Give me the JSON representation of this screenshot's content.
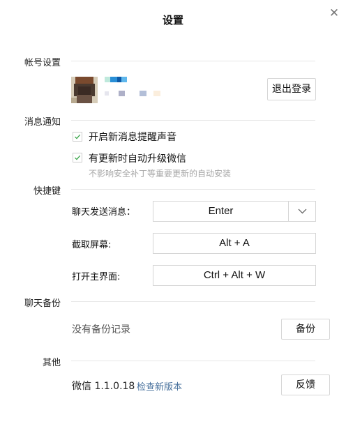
{
  "window": {
    "title": "设置"
  },
  "account": {
    "section_label": "帐号设置",
    "logout_label": "退出登录"
  },
  "notify": {
    "section_label": "消息通知",
    "opt_sound": "开启新消息提醒声音",
    "opt_autoupdate": "有更新时自动升级微信",
    "autoupdate_hint": "不影响安全补丁等重要更新的自动安装",
    "opt_sound_checked": true,
    "opt_autoupdate_checked": true
  },
  "shortcuts": {
    "section_label": "快捷键",
    "send_label": "聊天发送消息：",
    "send_value": "Enter",
    "capture_label": "截取屏幕:",
    "capture_value": "Alt + A",
    "open_label": "打开主界面:",
    "open_value": "Ctrl + Alt + W"
  },
  "backup": {
    "section_label": "聊天备份",
    "empty_text": "没有备份记录",
    "backup_label": "备份"
  },
  "other": {
    "section_label": "其他",
    "version": "微信 1.1.0.18",
    "check_update": "检查新版本",
    "feedback_label": "反馈"
  },
  "colors": {
    "check": "#3aa64a",
    "link": "#47709c",
    "divider": "#e6e6e6"
  }
}
